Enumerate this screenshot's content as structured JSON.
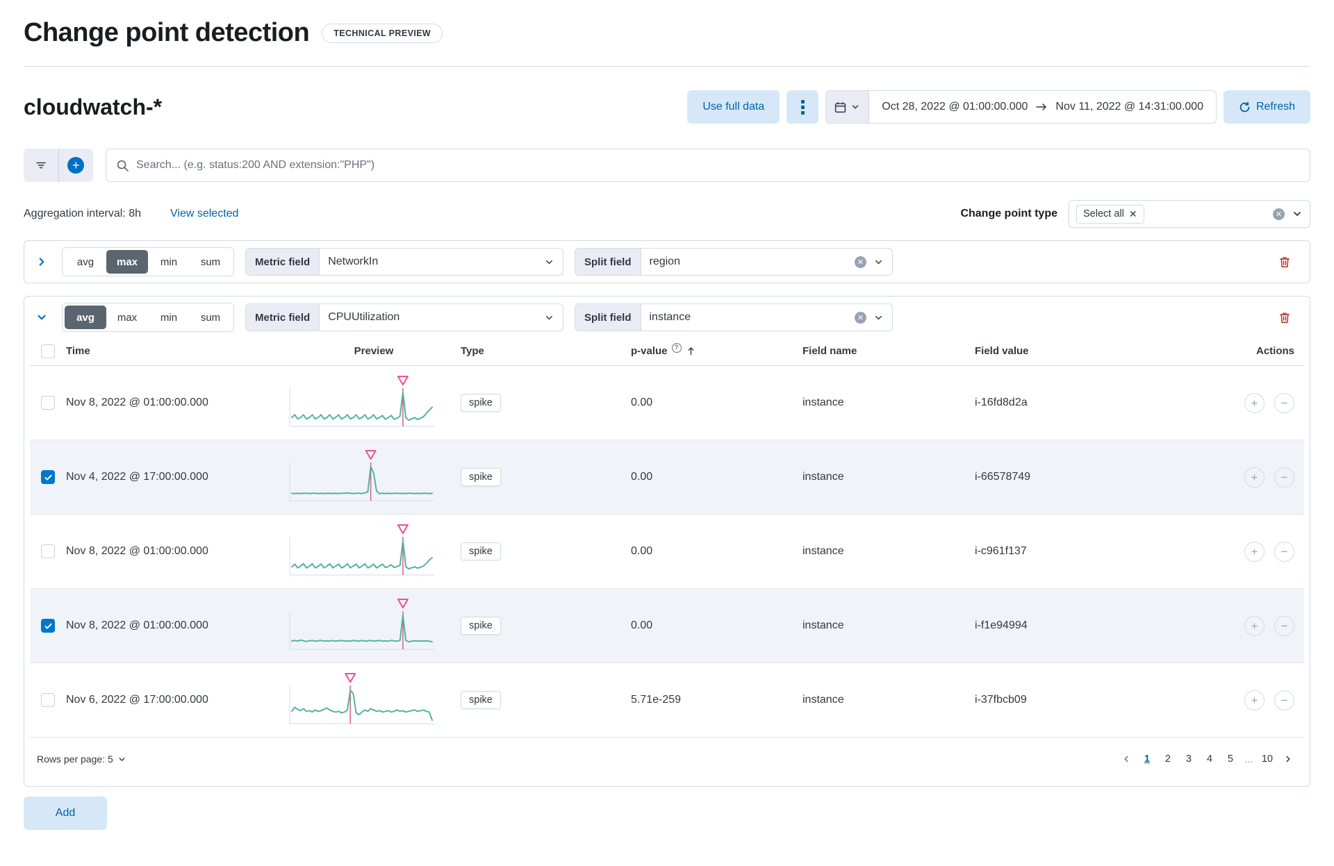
{
  "page": {
    "title": "Change point detection",
    "badge": "TECHNICAL PREVIEW",
    "index_title": "cloudwatch-*"
  },
  "toolbar": {
    "use_full_data": "Use full data",
    "date_start": "Oct 28, 2022 @ 01:00:00.000",
    "date_end": "Nov 11, 2022 @ 14:31:00.000",
    "refresh_label": "Refresh"
  },
  "search": {
    "placeholder": "Search... (e.g. status:200 AND extension:\"PHP\")"
  },
  "meta": {
    "aggregation_interval": "Aggregation interval: 8h",
    "view_selected": "View selected",
    "change_point_type_label": "Change point type",
    "selected_type": "Select all"
  },
  "labels": {
    "metric_field": "Metric field",
    "split_field": "Split field"
  },
  "configs": [
    {
      "collapsed": true,
      "agg_options": [
        "avg",
        "max",
        "min",
        "sum"
      ],
      "selected_agg": "max",
      "metric_value": "NetworkIn",
      "split_value": "region"
    },
    {
      "collapsed": false,
      "agg_options": [
        "avg",
        "max",
        "min",
        "sum"
      ],
      "selected_agg": "avg",
      "metric_value": "CPUUtilization",
      "split_value": "instance"
    }
  ],
  "table": {
    "columns": {
      "time": "Time",
      "preview": "Preview",
      "type": "Type",
      "p_value": "p-value",
      "field_name": "Field name",
      "field_value": "Field value",
      "actions": "Actions"
    },
    "rows": [
      {
        "checked": false,
        "time": "Nov 8, 2022 @ 01:00:00.000",
        "type": "spike",
        "p_value": "0.00",
        "field_name": "instance",
        "field_value": "i-16fd8d2a",
        "sparkline": {
          "spike_index": 38,
          "points": [
            0.8,
            0.72,
            0.84,
            0.8,
            0.72,
            0.84,
            0.8,
            0.72,
            0.84,
            0.8,
            0.72,
            0.84,
            0.8,
            0.72,
            0.84,
            0.8,
            0.72,
            0.84,
            0.8,
            0.72,
            0.84,
            0.8,
            0.72,
            0.84,
            0.8,
            0.72,
            0.84,
            0.8,
            0.72,
            0.84,
            0.8,
            0.74,
            0.85,
            0.8,
            0.74,
            0.85,
            0.82,
            0.76,
            0.06,
            0.8,
            0.88,
            0.84,
            0.8,
            0.86,
            0.82,
            0.78,
            0.68,
            0.58,
            0.5
          ]
        }
      },
      {
        "checked": true,
        "time": "Nov 4, 2022 @ 17:00:00.000",
        "type": "spike",
        "p_value": "0.00",
        "field_name": "instance",
        "field_value": "i-66578749",
        "sparkline": {
          "spike_index": 27,
          "points": [
            0.84,
            0.85,
            0.84,
            0.85,
            0.84,
            0.84,
            0.85,
            0.84,
            0.84,
            0.85,
            0.84,
            0.85,
            0.84,
            0.84,
            0.85,
            0.84,
            0.85,
            0.84,
            0.84,
            0.83,
            0.84,
            0.85,
            0.84,
            0.84,
            0.85,
            0.83,
            0.8,
            0.06,
            0.25,
            0.78,
            0.85,
            0.84,
            0.85,
            0.84,
            0.85,
            0.84,
            0.84,
            0.85,
            0.84,
            0.85,
            0.84,
            0.84,
            0.85,
            0.84,
            0.85,
            0.84,
            0.84,
            0.85,
            0.84
          ]
        }
      },
      {
        "checked": false,
        "time": "Nov 8, 2022 @ 01:00:00.000",
        "type": "spike",
        "p_value": "0.00",
        "field_name": "instance",
        "field_value": "i-c961f137",
        "sparkline": {
          "spike_index": 38,
          "points": [
            0.82,
            0.74,
            0.85,
            0.8,
            0.73,
            0.85,
            0.8,
            0.73,
            0.85,
            0.81,
            0.74,
            0.85,
            0.8,
            0.73,
            0.85,
            0.8,
            0.74,
            0.85,
            0.81,
            0.73,
            0.85,
            0.8,
            0.74,
            0.85,
            0.8,
            0.73,
            0.85,
            0.81,
            0.74,
            0.85,
            0.8,
            0.74,
            0.84,
            0.81,
            0.76,
            0.84,
            0.81,
            0.78,
            0.06,
            0.82,
            0.88,
            0.85,
            0.82,
            0.86,
            0.83,
            0.8,
            0.72,
            0.62,
            0.55
          ]
        }
      },
      {
        "checked": true,
        "time": "Nov 8, 2022 @ 01:00:00.000",
        "type": "spike",
        "p_value": "0.00",
        "field_name": "instance",
        "field_value": "i-f1e94994",
        "sparkline": {
          "spike_index": 38,
          "points": [
            0.82,
            0.8,
            0.82,
            0.79,
            0.81,
            0.83,
            0.81,
            0.8,
            0.82,
            0.81,
            0.8,
            0.82,
            0.81,
            0.82,
            0.8,
            0.82,
            0.81,
            0.8,
            0.82,
            0.81,
            0.82,
            0.8,
            0.81,
            0.82,
            0.8,
            0.82,
            0.81,
            0.8,
            0.82,
            0.81,
            0.8,
            0.82,
            0.81,
            0.82,
            0.8,
            0.81,
            0.82,
            0.8,
            0.06,
            0.8,
            0.84,
            0.82,
            0.81,
            0.82,
            0.81,
            0.82,
            0.81,
            0.82,
            0.84
          ]
        }
      },
      {
        "checked": false,
        "time": "Nov 6, 2022 @ 17:00:00.000",
        "type": "spike",
        "p_value": "5.71e-259",
        "field_name": "instance",
        "field_value": "i-37fbcb09",
        "sparkline": {
          "spike_index": 20,
          "points": [
            0.7,
            0.58,
            0.64,
            0.68,
            0.62,
            0.7,
            0.68,
            0.72,
            0.66,
            0.7,
            0.68,
            0.64,
            0.6,
            0.66,
            0.7,
            0.72,
            0.7,
            0.74,
            0.72,
            0.66,
            0.08,
            0.18,
            0.74,
            0.8,
            0.72,
            0.66,
            0.7,
            0.62,
            0.66,
            0.7,
            0.68,
            0.72,
            0.7,
            0.68,
            0.72,
            0.7,
            0.66,
            0.7,
            0.68,
            0.72,
            0.7,
            0.68,
            0.66,
            0.7,
            0.68,
            0.66,
            0.7,
            0.72,
            0.96
          ]
        }
      }
    ]
  },
  "pagination": {
    "rows_per_page_label": "Rows per page: 5",
    "pages": [
      "1",
      "2",
      "3",
      "4",
      "5",
      "…",
      "10"
    ],
    "current_page": "1"
  },
  "add_label": "Add",
  "colors": {
    "primary": "#0077cc",
    "link": "#0061a6",
    "light_button_bg": "#d6e8f8",
    "border": "#d3dae6",
    "text": "#343741",
    "subdued": "#69707d",
    "danger": "#bd271e",
    "spark_line": "#54b399",
    "spark_marker": "#f04e98",
    "spark_annotation": "#d36086",
    "selected_row_bg": "#f0f4f9",
    "selected_agg_bg": "#5a6570"
  }
}
